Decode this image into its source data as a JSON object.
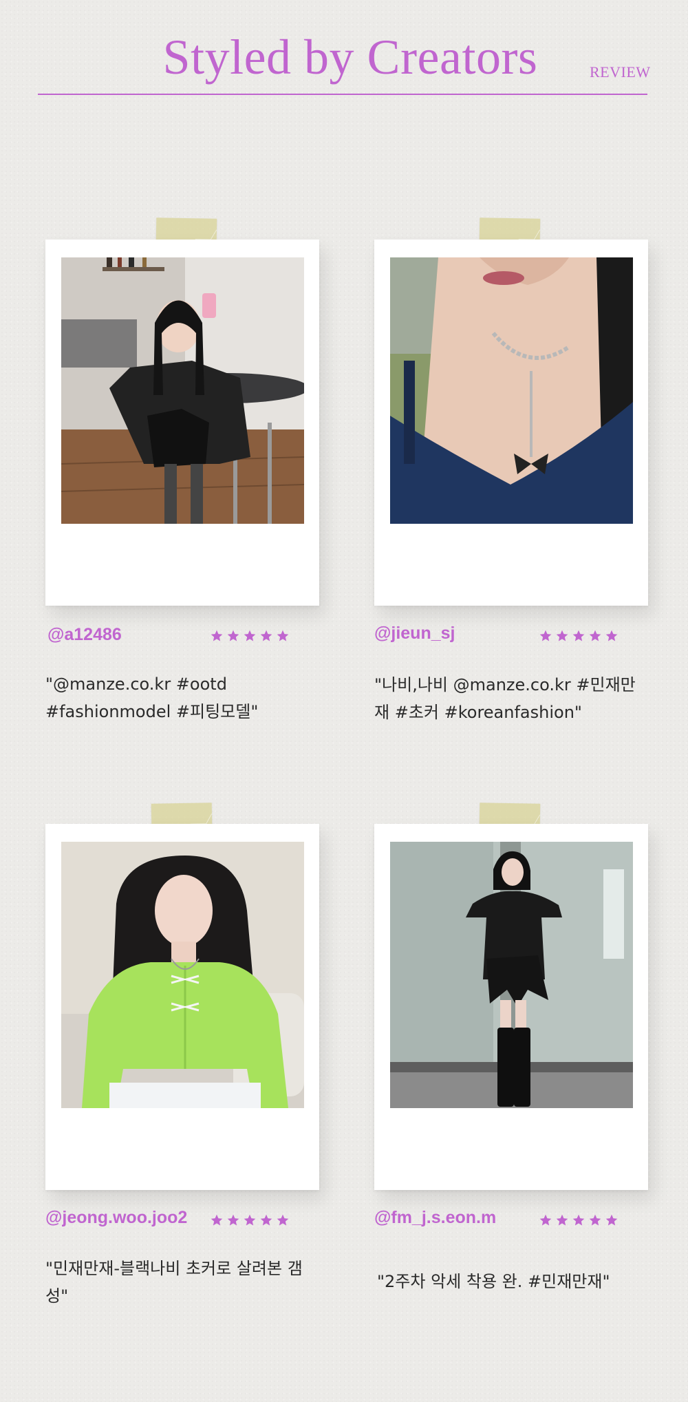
{
  "header": {
    "title": "Styled by Creators",
    "tag": "REVIEW"
  },
  "colors": {
    "accent": "#c065cf",
    "text": "#2a2a2a",
    "tape": "#dad6a0",
    "background": "#ecebe8"
  },
  "reviews": [
    {
      "handle": "@a12486",
      "rating": 5,
      "quote": "\"@manze.co.kr #ootd #fashionmodel #피팅모델\"",
      "photo": "woman in black leather jacket taking mirror selfie in cafe"
    },
    {
      "handle": "@jieun_sj",
      "rating": 5,
      "quote": "\"나비,나비 @manze.co.kr #민재만재 #초커 #koreanfashion\"",
      "photo": "close-up of butterfly chain necklace on navy top"
    },
    {
      "handle": "@jeong.woo.joo2",
      "rating": 5,
      "quote": "\"민재만재-블랙나비 초커로 살려본 갬성\"",
      "photo": "woman in lime green knit cardigan with butterfly necklace"
    },
    {
      "handle": "@fm_j.s.eon.m",
      "rating": 5,
      "quote": "\"2주차 악세 착용 완. #민재만재\"",
      "photo": "woman in black off-shoulder dress and lace-up boots against wall"
    }
  ]
}
